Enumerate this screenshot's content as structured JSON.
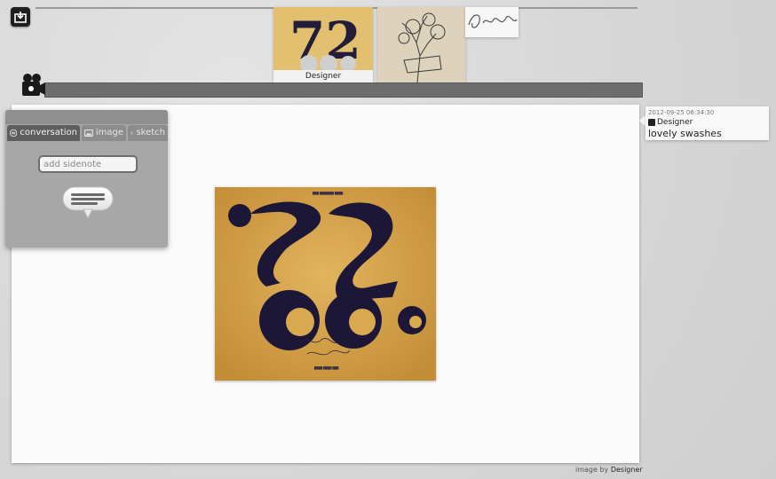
{
  "thumbnails": [
    {
      "name": "72 poster",
      "label": "Designer"
    },
    {
      "name": "tree illustration",
      "label": ""
    },
    {
      "name": "Good Work lettering",
      "label": ""
    }
  ],
  "panel": {
    "tabs": [
      {
        "label": "conversation",
        "icon": "speech-bubble-icon"
      },
      {
        "label": "image",
        "icon": "picture-icon"
      },
      {
        "label": "sketch",
        "icon": "pencil-icon"
      }
    ],
    "sidenote_placeholder": "add sidenote"
  },
  "comment": {
    "timestamp": "2012-09-25 06:34:30",
    "user": "Designer",
    "text": "lovely swashes"
  },
  "credit": {
    "prefix": "image by",
    "author": "Designer"
  },
  "colors": {
    "timeline_bar": "#6d6d6d",
    "active_tab": "#5e5e5e",
    "panel": "#a7a7a7"
  }
}
